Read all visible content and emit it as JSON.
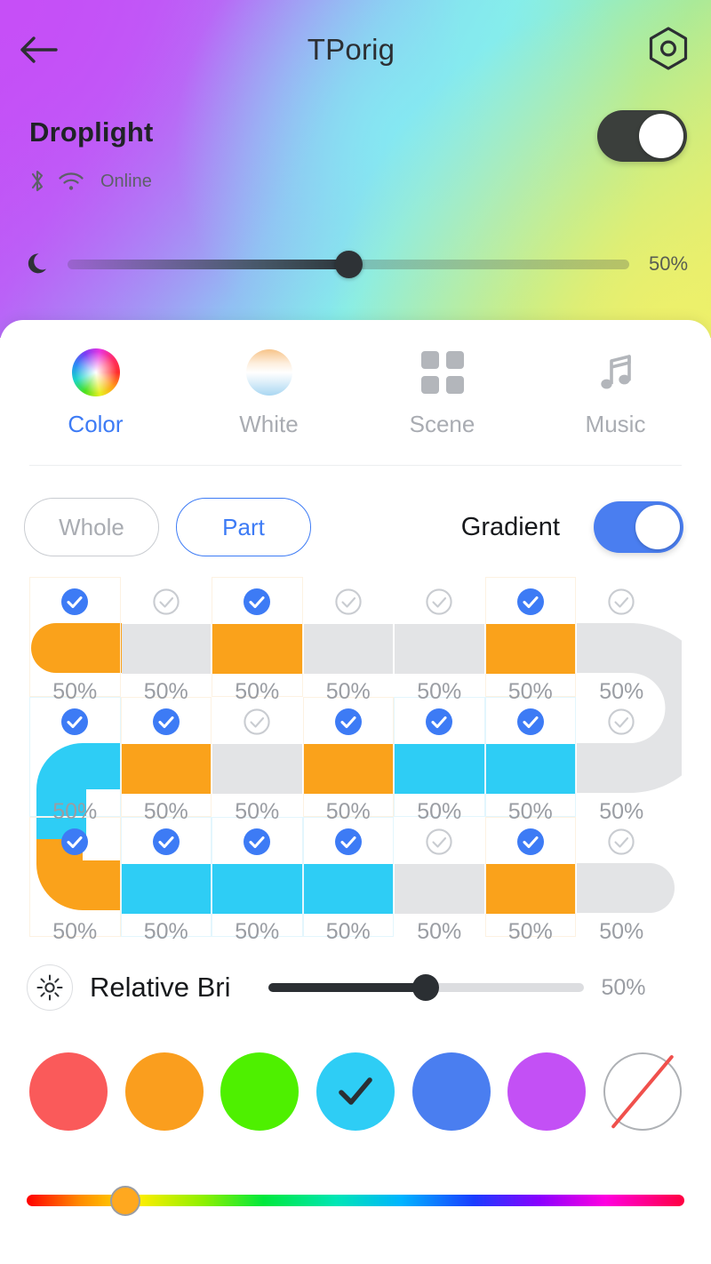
{
  "header": {
    "back_icon": "arrow-left-icon",
    "title": "TPorig",
    "settings_icon": "hex-gear-icon",
    "device_name": "Droplight",
    "status_text": "Online",
    "bluetooth_icon": "bluetooth-icon",
    "wifi_icon": "wifi-icon",
    "power_on": true,
    "brightness": {
      "icon": "moon-icon",
      "value_label": "50%",
      "percent": 50
    }
  },
  "tabs": [
    {
      "label": "Color",
      "icon": "color-wheel-icon",
      "active": true
    },
    {
      "label": "White",
      "icon": "white-gradient-icon",
      "active": false
    },
    {
      "label": "Scene",
      "icon": "grid-squares-icon",
      "active": false
    },
    {
      "label": "Music",
      "icon": "music-note-icon",
      "active": false
    }
  ],
  "mode": {
    "whole_label": "Whole",
    "part_label": "Part",
    "selected": "Part",
    "gradient_label": "Gradient",
    "gradient_on": true
  },
  "segments": {
    "columns": 7,
    "rows": [
      {
        "cells": [
          {
            "checked": true,
            "color": "orange",
            "pct": "50%"
          },
          {
            "checked": false,
            "color": "grey",
            "pct": "50%"
          },
          {
            "checked": true,
            "color": "orange",
            "pct": "50%"
          },
          {
            "checked": false,
            "color": "grey",
            "pct": "50%"
          },
          {
            "checked": false,
            "color": "grey",
            "pct": "50%"
          },
          {
            "checked": true,
            "color": "orange",
            "pct": "50%"
          },
          {
            "checked": false,
            "color": "grey",
            "pct": "50%"
          }
        ]
      },
      {
        "cells": [
          {
            "checked": true,
            "color": "cyan",
            "pct": "50%"
          },
          {
            "checked": true,
            "color": "orange",
            "pct": "50%"
          },
          {
            "checked": false,
            "color": "grey",
            "pct": "50%"
          },
          {
            "checked": true,
            "color": "orange",
            "pct": "50%"
          },
          {
            "checked": true,
            "color": "cyan",
            "pct": "50%"
          },
          {
            "checked": true,
            "color": "cyan",
            "pct": "50%"
          },
          {
            "checked": false,
            "color": "grey",
            "pct": "50%"
          }
        ]
      },
      {
        "cells": [
          {
            "checked": true,
            "color": "orange",
            "pct": "50%"
          },
          {
            "checked": true,
            "color": "cyan",
            "pct": "50%"
          },
          {
            "checked": true,
            "color": "cyan",
            "pct": "50%"
          },
          {
            "checked": true,
            "color": "cyan",
            "pct": "50%"
          },
          {
            "checked": false,
            "color": "grey",
            "pct": "50%"
          },
          {
            "checked": true,
            "color": "orange",
            "pct": "50%"
          },
          {
            "checked": false,
            "color": "grey",
            "pct": "50%"
          }
        ]
      }
    ],
    "colors": {
      "orange": "#faa21b",
      "cyan": "#2ecdf5",
      "grey": "#e3e4e6"
    }
  },
  "relative_brightness": {
    "icon": "sun-icon",
    "label": "Relative Bri",
    "value_label": "50%",
    "percent": 50
  },
  "swatches": [
    {
      "name": "red",
      "color": "#fa5a5a",
      "selected": false
    },
    {
      "name": "orange",
      "color": "#fa9e1e",
      "selected": false
    },
    {
      "name": "green",
      "color": "#4ef000",
      "selected": false
    },
    {
      "name": "cyan",
      "color": "#2ecdf5",
      "selected": true
    },
    {
      "name": "blue",
      "color": "#4a7ef0",
      "selected": false
    },
    {
      "name": "purple",
      "color": "#c350f5",
      "selected": false
    },
    {
      "name": "none",
      "color": "#ffffff",
      "selected": false
    }
  ],
  "hue_slider": {
    "thumb_percent": 15,
    "thumb_color": "#ffa81f"
  },
  "accent": {
    "blue": "#3d7bf5",
    "toggle_blue": "#4a7ef0",
    "dark": "#2b2f33"
  }
}
